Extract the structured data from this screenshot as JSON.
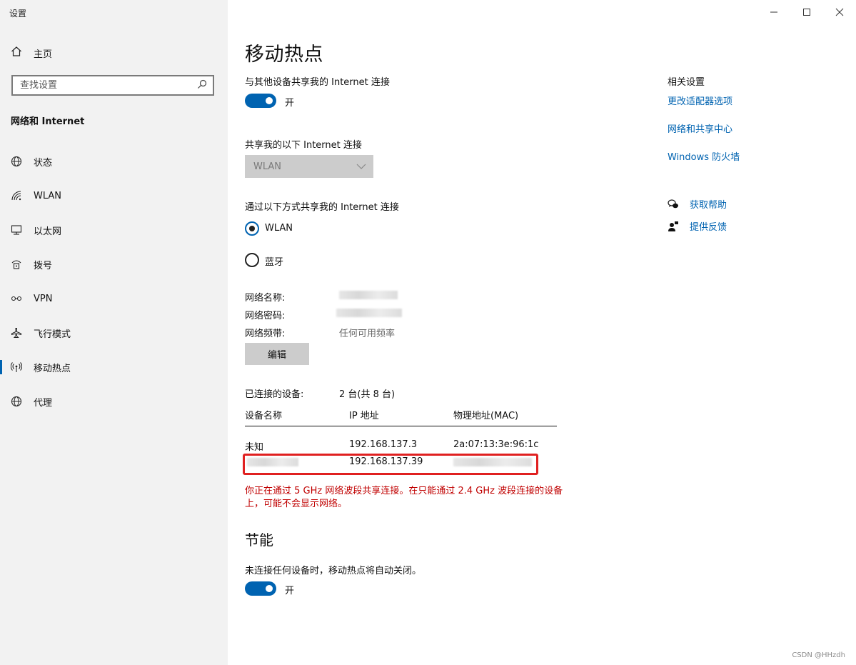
{
  "window": {
    "title": "设置"
  },
  "sidebar": {
    "home_label": "主页",
    "search_placeholder": "查找设置",
    "section": "网络和 Internet",
    "items": [
      {
        "label": "状态",
        "icon": "globe-status-icon"
      },
      {
        "label": "WLAN",
        "icon": "wifi-icon"
      },
      {
        "label": "以太网",
        "icon": "ethernet-icon"
      },
      {
        "label": "拨号",
        "icon": "dialup-icon"
      },
      {
        "label": "VPN",
        "icon": "vpn-icon"
      },
      {
        "label": "飞行模式",
        "icon": "airplane-icon"
      },
      {
        "label": "移动热点",
        "icon": "hotspot-icon",
        "active": true
      },
      {
        "label": "代理",
        "icon": "globe-proxy-icon"
      }
    ]
  },
  "main": {
    "title": "移动热点",
    "share_label": "与其他设备共享我的 Internet 连接",
    "share_state": "开",
    "source_label": "共享我的以下 Internet 连接",
    "source_value": "WLAN",
    "method_label": "通过以下方式共享我的 Internet 连接",
    "method_options": [
      {
        "label": "WLAN",
        "checked": true
      },
      {
        "label": "蓝牙",
        "checked": false
      }
    ],
    "network_name_label": "网络名称:",
    "network_password_label": "网络密码:",
    "network_band_label": "网络频带:",
    "network_band_value": "任何可用频率",
    "edit_button": "编辑",
    "connected_label": "已连接的设备:",
    "connected_value": "2 台(共 8 台)",
    "table_headers": [
      "设备名称",
      "IP 地址",
      "物理地址(MAC)"
    ],
    "devices": [
      {
        "name": "未知",
        "ip": "192.168.137.3",
        "mac": "2a:07:13:3e:96:1c"
      },
      {
        "name": "",
        "ip": "192.168.137.39",
        "mac": ""
      }
    ],
    "warning": "你正在通过 5 GHz 网络波段共享连接。在只能通过 2.4 GHz 波段连接的设备上，可能不会显示网络。",
    "power_title": "节能",
    "power_label": "未连接任何设备时，移动热点将自动关闭。",
    "power_state": "开"
  },
  "related": {
    "title": "相关设置",
    "links": [
      "更改适配器选项",
      "网络和共享中心",
      "Windows 防火墙"
    ],
    "help": "获取帮助",
    "feedback": "提供反馈"
  },
  "watermark": "CSDN @HHzdh",
  "colors": {
    "accent": "#0063b1",
    "warning": "#c00000",
    "highlight_box": "#e02020"
  }
}
